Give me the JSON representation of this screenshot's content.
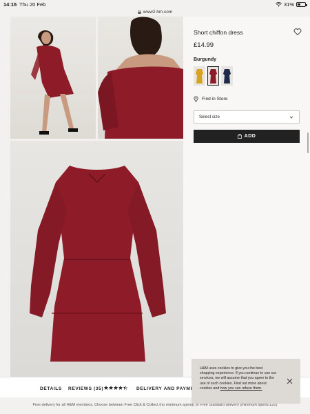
{
  "status_bar": {
    "time": "14:15",
    "date": "Thu 20 Feb",
    "battery": "31%",
    "battery_level": 0.31
  },
  "browser": {
    "url": "www2.hm.com"
  },
  "product": {
    "title": "Short chiffon dress",
    "price": "£14.99",
    "color_label": "Burgundy",
    "swatches": [
      {
        "name": "mustard",
        "color": "#d9a322"
      },
      {
        "name": "burgundy",
        "color": "#8e1c28",
        "selected": true
      },
      {
        "name": "navy",
        "color": "#1f2a4a"
      }
    ],
    "find_in_store": "Find in Store",
    "select_size": "Select size",
    "add_button": "ADD"
  },
  "tabs": {
    "details": "DETAILS",
    "reviews": "REVIEWS (35)",
    "rating": 4.5,
    "delivery": "DELIVERY AND PAYMEI"
  },
  "footer": {
    "text": "Free delivery for all H&M members. Choose between Free Click & Collect (no minimum spend) or Free Standard delivery (minimum spend £20)"
  },
  "cookie": {
    "text": "H&M uses cookies to give you the best shopping experience. If you continue to use our services, we will assume that you agree to the use of such cookies. Find out more about cookies and ",
    "link": "how you can refuse them."
  },
  "colors": {
    "dress": "#8e1c28",
    "add_button_bg": "#222222",
    "panel_bg": "#f8f7f6"
  }
}
